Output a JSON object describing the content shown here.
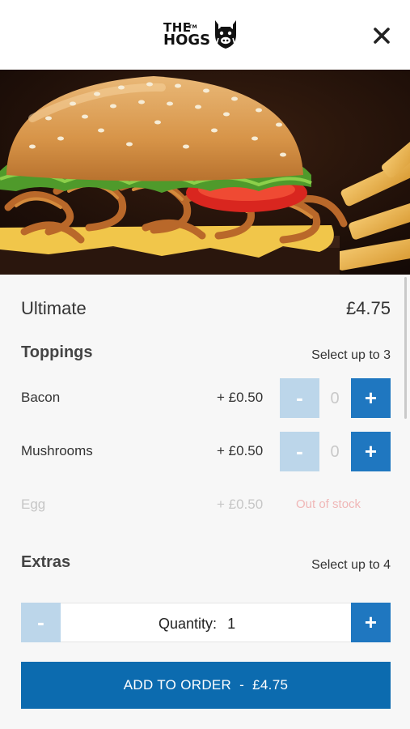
{
  "header": {
    "logo_line1": "THE",
    "logo_tm": "TM",
    "logo_line2": "HOGS",
    "close_icon": "close-icon"
  },
  "product": {
    "name": "Ultimate",
    "price": "£4.75",
    "image_icon": "burger-photo"
  },
  "toppings": {
    "title": "Toppings",
    "hint": "Select up to 3",
    "items": [
      {
        "name": "Bacon",
        "price": "+ £0.50",
        "qty": "0",
        "minus": "-",
        "plus": "+"
      },
      {
        "name": "Mushrooms",
        "price": "+ £0.50",
        "qty": "0",
        "minus": "-",
        "plus": "+"
      },
      {
        "name": "Egg",
        "price": "+ £0.50",
        "status": "Out of stock"
      }
    ]
  },
  "extras": {
    "title": "Extras",
    "hint": "Select up to 4"
  },
  "quantity": {
    "label": "Quantity:",
    "value": "1",
    "minus": "-",
    "plus": "+"
  },
  "add_to_order": {
    "label": "ADD TO ORDER  -  £4.75"
  },
  "colors": {
    "primary": "#0c6baf",
    "plus_button": "#1f77c0",
    "minus_button": "#bcd6ea",
    "out_of_stock": "#f0b7b7"
  }
}
